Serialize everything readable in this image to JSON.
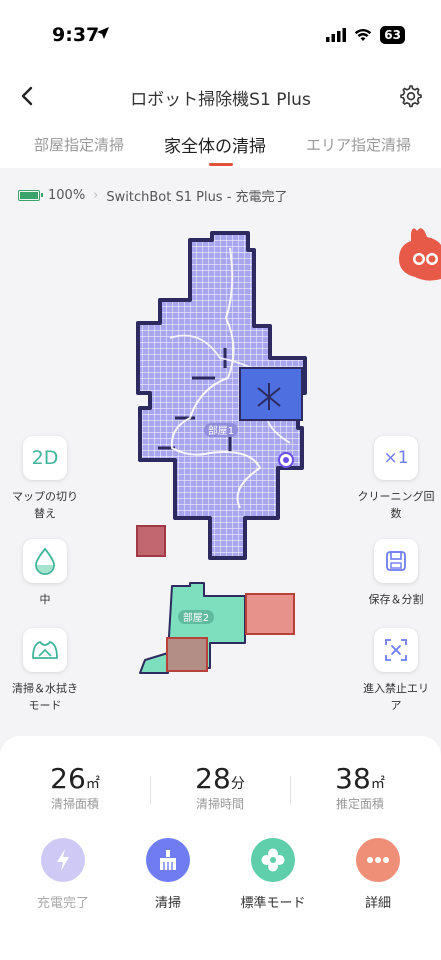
{
  "status": {
    "time": "9:37",
    "battery": "63"
  },
  "nav": {
    "title": "ロボット掃除機S1 Plus"
  },
  "tabs": [
    {
      "label": "部屋指定清掃"
    },
    {
      "label": "家全体の清掃"
    },
    {
      "label": "エリア指定清掃"
    }
  ],
  "device": {
    "battery": "100%",
    "name": "SwitchBot S1 Plus - 充電完了"
  },
  "map": {
    "room1": "部屋1",
    "room2": "部屋2"
  },
  "left_controls": [
    {
      "label": "マップの切り替え",
      "icon": "2D"
    },
    {
      "label": "中",
      "icon": "water-drop-icon"
    },
    {
      "label": "清掃＆水拭きモード",
      "icon": "mop-icon"
    }
  ],
  "right_controls": [
    {
      "label": "クリーニング回数",
      "icon": "×1"
    },
    {
      "label": "保存＆分割",
      "icon": "save-icon"
    },
    {
      "label": "進入禁止エリア",
      "icon": "no-go-zone-icon"
    }
  ],
  "stats": [
    {
      "value": "26",
      "unit": "㎡",
      "label": "清掃面積"
    },
    {
      "value": "28",
      "unit": "分",
      "label": "清掃時間"
    },
    {
      "value": "38",
      "unit": "㎡",
      "label": "推定面積"
    }
  ],
  "actions": [
    {
      "label": "充電完了",
      "color": "#cfc9f5"
    },
    {
      "label": "清掃",
      "color": "#6f7cf2"
    },
    {
      "label": "標準モード",
      "color": "#5fcfab"
    },
    {
      "label": "詳細",
      "color": "#ef8f78"
    }
  ]
}
